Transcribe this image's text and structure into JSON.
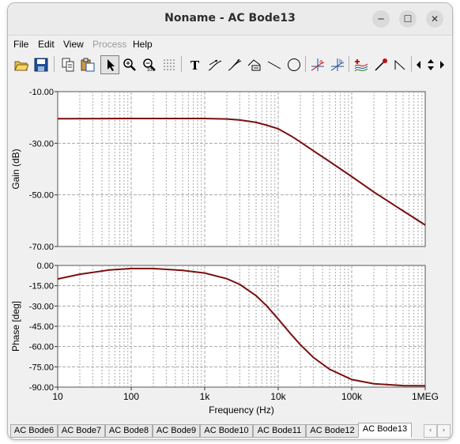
{
  "window": {
    "title": "Noname - AC Bode13",
    "minimize": "─",
    "maximize": "☐",
    "close": "✕"
  },
  "menu": [
    "File",
    "Edit",
    "View",
    "Process",
    "Help"
  ],
  "toolbar": {
    "tools": [
      "open-icon",
      "save-icon",
      "copy-icon",
      "paste-icon",
      "pointer-icon",
      "zoom-in-icon",
      "zoom-out-icon",
      "grid-icon",
      "text-icon",
      "marker-icon",
      "curve-marker-icon",
      "annotation-icon",
      "line-icon",
      "circle-icon",
      "cursor-a-icon",
      "cursor-b-icon",
      "add-curve-icon",
      "probe-icon",
      "pulse-icon",
      "nav-left-icon",
      "nav-updown-icon",
      "nav-right-icon"
    ]
  },
  "colors": {
    "curve": "#7a1010",
    "grid": "#a8a8a8",
    "plot_bg": "#ffffff"
  },
  "chart_data": [
    {
      "type": "line",
      "ylabel": "Gain (dB)",
      "ylim": [
        -70,
        -10
      ],
      "y_ticks": [
        "-10.00",
        "-30.00",
        "-50.00",
        "-70.00"
      ],
      "x_scale": "log",
      "xlim": [
        10,
        1000000
      ],
      "grid": true,
      "series": [
        {
          "x": [
            10,
            100,
            1000,
            2000,
            3000,
            5000,
            7000,
            10000,
            15000,
            20000,
            30000,
            50000,
            100000,
            200000,
            500000,
            1000000
          ],
          "y": [
            -20.5,
            -20.4,
            -20.4,
            -20.6,
            -21.0,
            -21.9,
            -23.0,
            -24.4,
            -27.2,
            -29.5,
            -32.9,
            -37.1,
            -42.9,
            -48.9,
            -56.2,
            -61.7
          ]
        }
      ]
    },
    {
      "type": "line",
      "ylabel": "Phase [deg]",
      "xlabel": "Frequency (Hz)",
      "ylim": [
        -90,
        0
      ],
      "y_ticks": [
        "0.00",
        "-15.00",
        "-30.00",
        "-45.00",
        "-60.00",
        "-75.00",
        "-90.00"
      ],
      "x_scale": "log",
      "xlim": [
        10,
        1000000
      ],
      "x_ticks": [
        "10",
        "100",
        "1k",
        "10k",
        "100k",
        "1MEG"
      ],
      "grid": true,
      "series": [
        {
          "x": [
            10,
            20,
            50,
            100,
            200,
            500,
            1000,
            2000,
            3000,
            5000,
            7000,
            10000,
            15000,
            20000,
            30000,
            50000,
            100000,
            200000,
            500000,
            1000000
          ],
          "y": [
            -10.0,
            -6.5,
            -3.4,
            -2.3,
            -2.3,
            -3.6,
            -5.6,
            -9.8,
            -14.0,
            -22.4,
            -30.0,
            -39.6,
            -51.0,
            -58.6,
            -68.0,
            -76.8,
            -84.4,
            -87.5,
            -88.9,
            -89.0
          ]
        }
      ]
    }
  ],
  "tabs": {
    "items": [
      "AC Bode6",
      "AC Bode7",
      "AC Bode8",
      "AC Bode9",
      "AC Bode10",
      "AC Bode11",
      "AC Bode12",
      "AC Bode13"
    ],
    "active": 7,
    "prev": "‹",
    "next": "›"
  }
}
